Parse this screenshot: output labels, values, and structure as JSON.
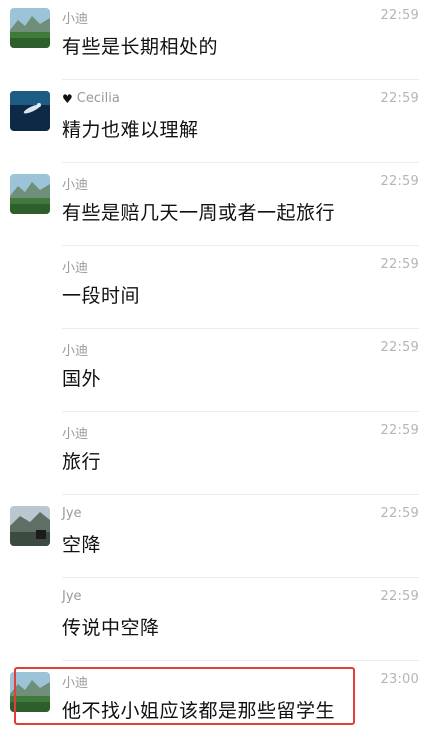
{
  "messages": [
    {
      "sender": "小迪",
      "time": "22:59",
      "text": "有些是长期相处的",
      "avatar": "landscape-avatar"
    },
    {
      "sender": "Cecilia",
      "sender_icon": "heart-icon",
      "time": "22:59",
      "text": "精力也难以理解",
      "avatar": "diver-avatar"
    },
    {
      "sender": "小迪",
      "time": "22:59",
      "text": "有些是赔几天一周或者一起旅行",
      "avatar": "landscape-avatar"
    },
    {
      "sender": "小迪",
      "time": "22:59",
      "text": "一段时间"
    },
    {
      "sender": "小迪",
      "time": "22:59",
      "text": "国外"
    },
    {
      "sender": "小迪",
      "time": "22:59",
      "text": "旅行"
    },
    {
      "sender": "Jye",
      "time": "22:59",
      "text": "空降",
      "avatar": "mountain-avatar"
    },
    {
      "sender": "Jye",
      "time": "22:59",
      "text": "传说中空降"
    },
    {
      "sender": "小迪",
      "time": "23:00",
      "text": "他不找小姐应该都是那些留学生",
      "avatar": "landscape-avatar",
      "highlighted": true
    }
  ],
  "colors": {
    "highlight": "#e23c3c",
    "name": "#9a9a9a",
    "time": "#b5b5b5",
    "text": "#111111"
  }
}
